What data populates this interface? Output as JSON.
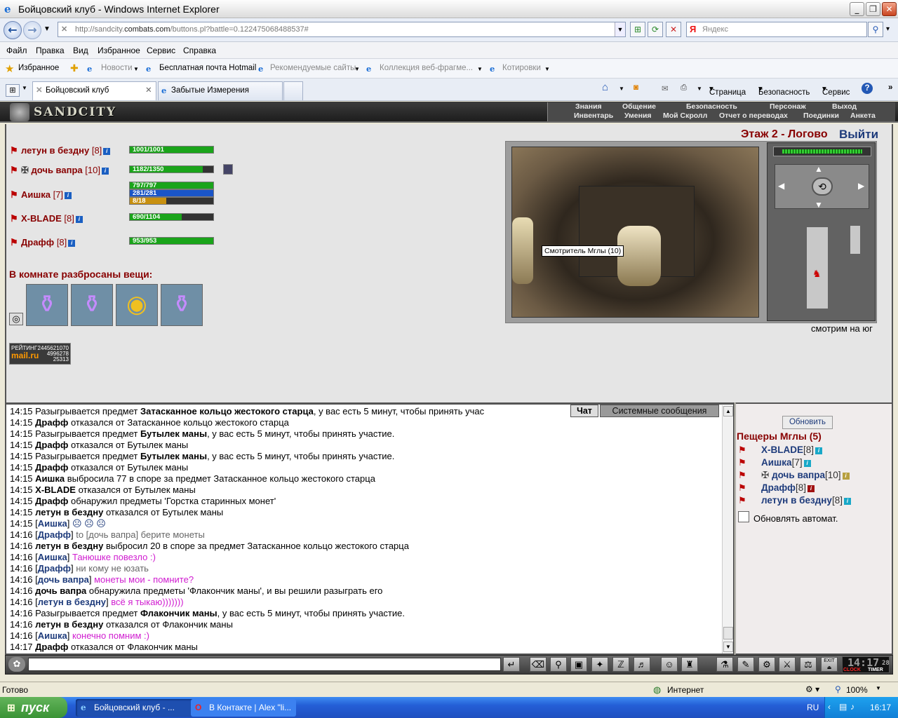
{
  "window": {
    "title": "Бойцовский клуб - Windows Internet Explorer"
  },
  "address": {
    "url_prefix": "http://sandcity.",
    "url_domain": "combats.com",
    "url_suffix": "/buttons.pl?battle=0.122475068488537#",
    "search_placeholder": "Яндекс"
  },
  "menu": [
    "Файл",
    "Правка",
    "Вид",
    "Избранное",
    "Сервис",
    "Справка"
  ],
  "favorites": {
    "label": "Избранное",
    "items": [
      "Новости",
      "Бесплатная почта Hotmail",
      "Рекомендуемые сайты",
      "Коллекция веб-фрагме...",
      "Котировки"
    ]
  },
  "tabs": [
    {
      "label": "Бойцовский клуб"
    },
    {
      "label": "Забытые Измерения"
    }
  ],
  "tab_tools": [
    "Страница",
    "Безопасность",
    "Сервис"
  ],
  "game": {
    "logo": "SANDCITY",
    "menu_top": [
      "Знания",
      "Общение",
      "Безопасность",
      "Персонаж",
      "Выход"
    ],
    "menu_bottom": [
      "Инвентарь",
      "Умения",
      "Мой Скролл",
      "Отчет о переводах",
      "Поединки",
      "Анкета"
    ],
    "location": "Этаж 2 - Логово",
    "exit": "Выйти",
    "facing": "смотрим на юг",
    "npc_tooltip": "Смотритель Мглы (10)",
    "items_header": "В комнате разбросаны вещи:",
    "counter": {
      "label": "РЕЙТИНГ",
      "n1": "2445621070",
      "brand": "mail.ru",
      "n2": "4996278",
      "n3": "25313"
    },
    "players": [
      {
        "name": "летун в бездну",
        "level": "[8]",
        "hp": "1001/1001",
        "hp_frac": 1.0
      },
      {
        "name": "дочь вапра",
        "level": "[10]",
        "hp": "1182/1350",
        "hp_frac": 0.875
      },
      {
        "name": "Аишка",
        "level": "[7]",
        "hp": "797/797",
        "hp_frac": 1.0,
        "mana": "281/281",
        "mana_frac": 1.0,
        "extra": "8/18",
        "extra_frac": 0.44
      },
      {
        "name": "X-BLADE",
        "level": "[8]",
        "hp": "690/1104",
        "hp_frac": 0.625
      },
      {
        "name": "Драфф",
        "level": "[8]",
        "hp": "953/953",
        "hp_frac": 1.0
      }
    ]
  },
  "chat": {
    "tab_chat": "Чат",
    "tab_system": "Системные сообщения",
    "lines": [
      {
        "t": "14:15",
        "a": "Разыгрывается предмет ",
        "b": "Затасканное кольцо жестокого старца",
        "c": ", у вас есть 5 минут, чтобы принять учас"
      },
      {
        "t": "14:15",
        "b0": "Драфф",
        "c": " отказался от Затасканное кольцо жестокого старца"
      },
      {
        "t": "14:15",
        "a": "Разыгрывается предмет ",
        "b": "Бутылек маны",
        "c": ", у вас есть 5 минут, чтобы принять участие."
      },
      {
        "t": "14:15",
        "b0": "Драфф",
        "c": " отказался от Бутылек маны"
      },
      {
        "t": "14:15",
        "a": "Разыгрывается предмет ",
        "b": "Бутылек маны",
        "c": ", у вас есть 5 минут, чтобы принять участие."
      },
      {
        "t": "14:15",
        "b0": "Драфф",
        "c": " отказался от Бутылек маны"
      },
      {
        "t": "14:15",
        "b0": "Аишка",
        "c": " выбросила 77 в споре за предмет Затасканное кольцо жестокого старца"
      },
      {
        "t": "14:15",
        "b0": "X-BLADE",
        "c": " отказался от Бутылек маны"
      },
      {
        "t": "14:15",
        "b0": "Драфф",
        "c": " обнаружил предметы 'Горстка старинных монет'"
      },
      {
        "t": "14:15",
        "b0": "летун в бездну",
        "c": " отказался от Бутылек маны"
      },
      {
        "t": "14:15",
        "n": "Аишка",
        "smile": "☹ ☹ ☹"
      },
      {
        "t": "14:16",
        "n": "Драфф",
        "g": " to [дочь вапра] берите монеты"
      },
      {
        "t": "14:16",
        "b0": "летун в бездну",
        "c": " выбросил 20 в споре за предмет Затасканное кольцо жестокого старца"
      },
      {
        "t": "14:16",
        "n": "Аишка",
        "p": " Танюшке повезло :)"
      },
      {
        "t": "14:16",
        "n": "Драфф",
        "g": " ни кому не юзать"
      },
      {
        "t": "14:16",
        "n": "дочь вапра",
        "p": " монеты мои - помните?"
      },
      {
        "t": "14:16",
        "b0": "дочь вапра",
        "c": " обнаружила предметы 'Флакончик маны', и вы решили разыграть его"
      },
      {
        "t": "14:16",
        "n": "летун в бездну",
        "p": " всё я тыкаю)))))))"
      },
      {
        "t": "14:16",
        "a": "Разыгрывается предмет ",
        "b": "Флакончик маны",
        "c": ", у вас есть 5 минут, чтобы принять участие."
      },
      {
        "t": "14:16",
        "b0": "летун в бездну",
        "c": " отказался от Флакончик маны"
      },
      {
        "t": "14:16",
        "n": "Аишка",
        "p": " конечно помним :)"
      },
      {
        "t": "14:17",
        "b0": "Драфф",
        "c": " отказался от Флакончик маны"
      }
    ]
  },
  "room": {
    "refresh": "Обновить",
    "title": "Пещеры Мглы (5)",
    "auto_refresh": "Обновлять автомат.",
    "members": [
      {
        "name": "X-BLADE",
        "level": "[8]"
      },
      {
        "name": "Аишка",
        "level": "[7]"
      },
      {
        "name": "дочь вапра",
        "level": "[10]"
      },
      {
        "name": "Драфф",
        "level": "[8]"
      },
      {
        "name": "летун в бездну",
        "level": "[8]"
      }
    ]
  },
  "clock": {
    "time": "14:17",
    "sec": "28",
    "clock_label": "CLOCK",
    "timer_label": "TIMER",
    "exit_label": "EXIT"
  },
  "status": {
    "left": "Готово",
    "zone": "Интернет",
    "zoom": "100%"
  },
  "taskbar": {
    "start": "пуск",
    "tasks": [
      "Бойцовский клуб - ...",
      "В Контакте | Alex \"li..."
    ],
    "lang": "RU",
    "time": "16:17"
  },
  "colors": {
    "hp": "#1aa41a",
    "mana": "#1a55c8",
    "extra": "#c89010",
    "player_name": "#800000",
    "chat_nick": "#1e3b7b",
    "private": "#d01cd0"
  }
}
